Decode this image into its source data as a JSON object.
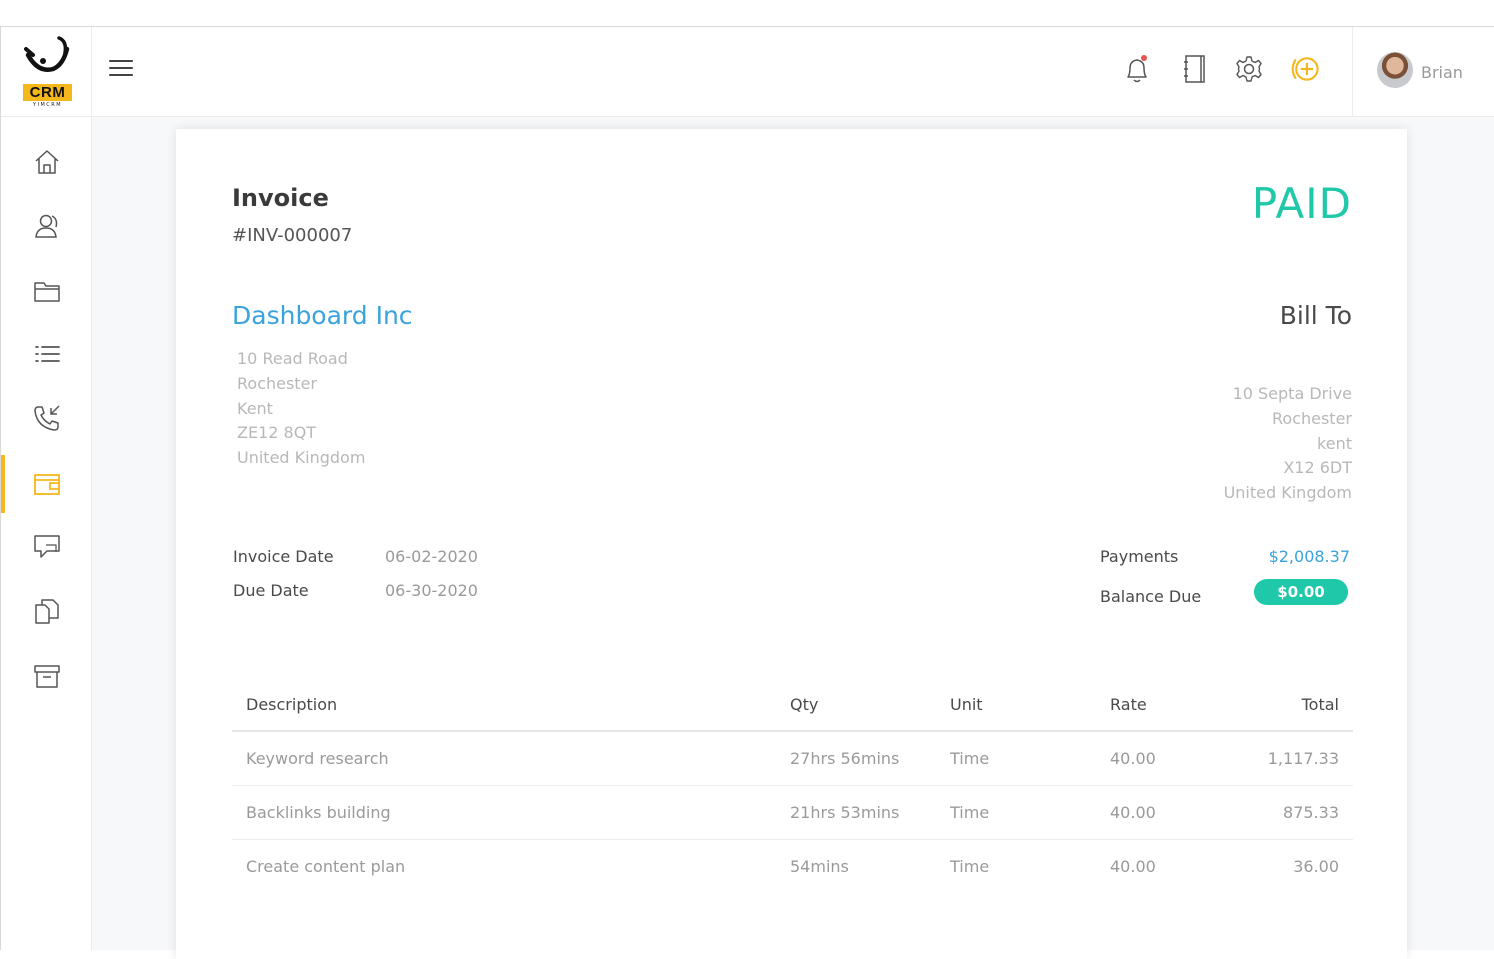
{
  "app": {
    "logo_text": "CRM",
    "logo_sub": "YIMCRM",
    "user_name": "Brian",
    "accent": "#f5b81c"
  },
  "sidebar": {
    "items": [
      {
        "icon": "home-icon"
      },
      {
        "icon": "contacts-icon"
      },
      {
        "icon": "folder-icon"
      },
      {
        "icon": "list-icon"
      },
      {
        "icon": "phone-icon"
      },
      {
        "icon": "wallet-icon",
        "active": true
      },
      {
        "icon": "chat-icon"
      },
      {
        "icon": "documents-icon"
      },
      {
        "icon": "archive-icon"
      }
    ]
  },
  "topbar": {
    "icons": [
      "bell-icon",
      "notebook-icon",
      "gear-icon",
      "add-circle-icon"
    ]
  },
  "invoice": {
    "title": "Invoice",
    "number": "#INV-000007",
    "status": "PAID",
    "status_color": "#1fc8a8",
    "from": {
      "company": "Dashboard Inc",
      "address": [
        "10 Read Road",
        "Rochester",
        "Kent",
        "ZE12 8QT",
        "United Kingdom"
      ]
    },
    "to": {
      "heading": "Bill To",
      "address": [
        "10 Septa Drive",
        "Rochester",
        "kent",
        "X12 6DT",
        "United Kingdom"
      ]
    },
    "dates": {
      "invoice_date_label": "Invoice Date",
      "invoice_date": "06-02-2020",
      "due_date_label": "Due Date",
      "due_date": "06-30-2020"
    },
    "totals": {
      "payments_label": "Payments",
      "payments": "$2,008.37",
      "balance_label": "Balance Due",
      "balance": "$0.00"
    },
    "table": {
      "headers": {
        "description": "Description",
        "qty": "Qty",
        "unit": "Unit",
        "rate": "Rate",
        "total": "Total"
      },
      "rows": [
        {
          "description": "Keyword research",
          "qty": "27hrs 56mins",
          "unit": "Time",
          "rate": "40.00",
          "total": "1,117.33"
        },
        {
          "description": "Backlinks building",
          "qty": "21hrs 53mins",
          "unit": "Time",
          "rate": "40.00",
          "total": "875.33"
        },
        {
          "description": "Create content plan",
          "qty": "54mins",
          "unit": "Time",
          "rate": "40.00",
          "total": "36.00"
        }
      ]
    }
  }
}
